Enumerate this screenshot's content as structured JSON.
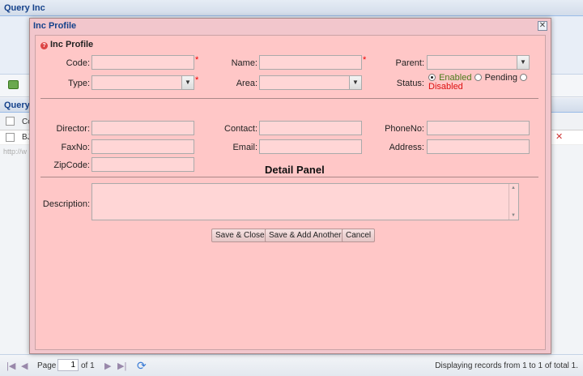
{
  "app": {
    "title": "Query Inc",
    "grid_title": "Query",
    "grid_col_partial": "Co",
    "grid_row_partial": "BJ",
    "url_partial": "http://w"
  },
  "pager": {
    "page_label": "Page",
    "page_value": "1",
    "of_label": "of 1",
    "display_text": "Displaying records from 1 to 1 of total 1."
  },
  "dialog": {
    "title": "Inc Profile",
    "close_glyph": "✕",
    "section_title": "Inc Profile",
    "labels": {
      "code": "Code:",
      "name": "Name:",
      "parent": "Parent:",
      "type": "Type:",
      "area": "Area:",
      "status": "Status:",
      "director": "Director:",
      "contact": "Contact:",
      "phoneno": "PhoneNo:",
      "faxno": "FaxNo:",
      "email": "Email:",
      "address": "Address:",
      "zipcode": "ZipCode:",
      "description": "Description:"
    },
    "required_mark": "*",
    "values": {
      "code": "",
      "name": "",
      "parent": "",
      "type": "",
      "area": "",
      "director": "",
      "contact": "",
      "phoneno": "",
      "faxno": "",
      "email": "",
      "address": "",
      "zipcode": "",
      "description": ""
    },
    "status_options": [
      "Enabled",
      "Pending",
      "Disabled"
    ],
    "status_selected": "Enabled",
    "panel_title": "Detail Panel",
    "buttons": {
      "save_close": "Save & Close",
      "save_add": "Save & Add Another",
      "cancel": "Cancel"
    }
  },
  "colors": {
    "dialog_frame": "#f2c6cc",
    "dialog_body": "#ffc7c7",
    "title_text": "#15428b",
    "required": "#e00000",
    "enabled_text": "#4a7a1a",
    "disabled_text": "#d11111"
  },
  "icons": {
    "section": "help-circle-icon",
    "close": "close-icon",
    "dropdown": "chevron-down-icon",
    "refresh": "refresh-icon"
  }
}
